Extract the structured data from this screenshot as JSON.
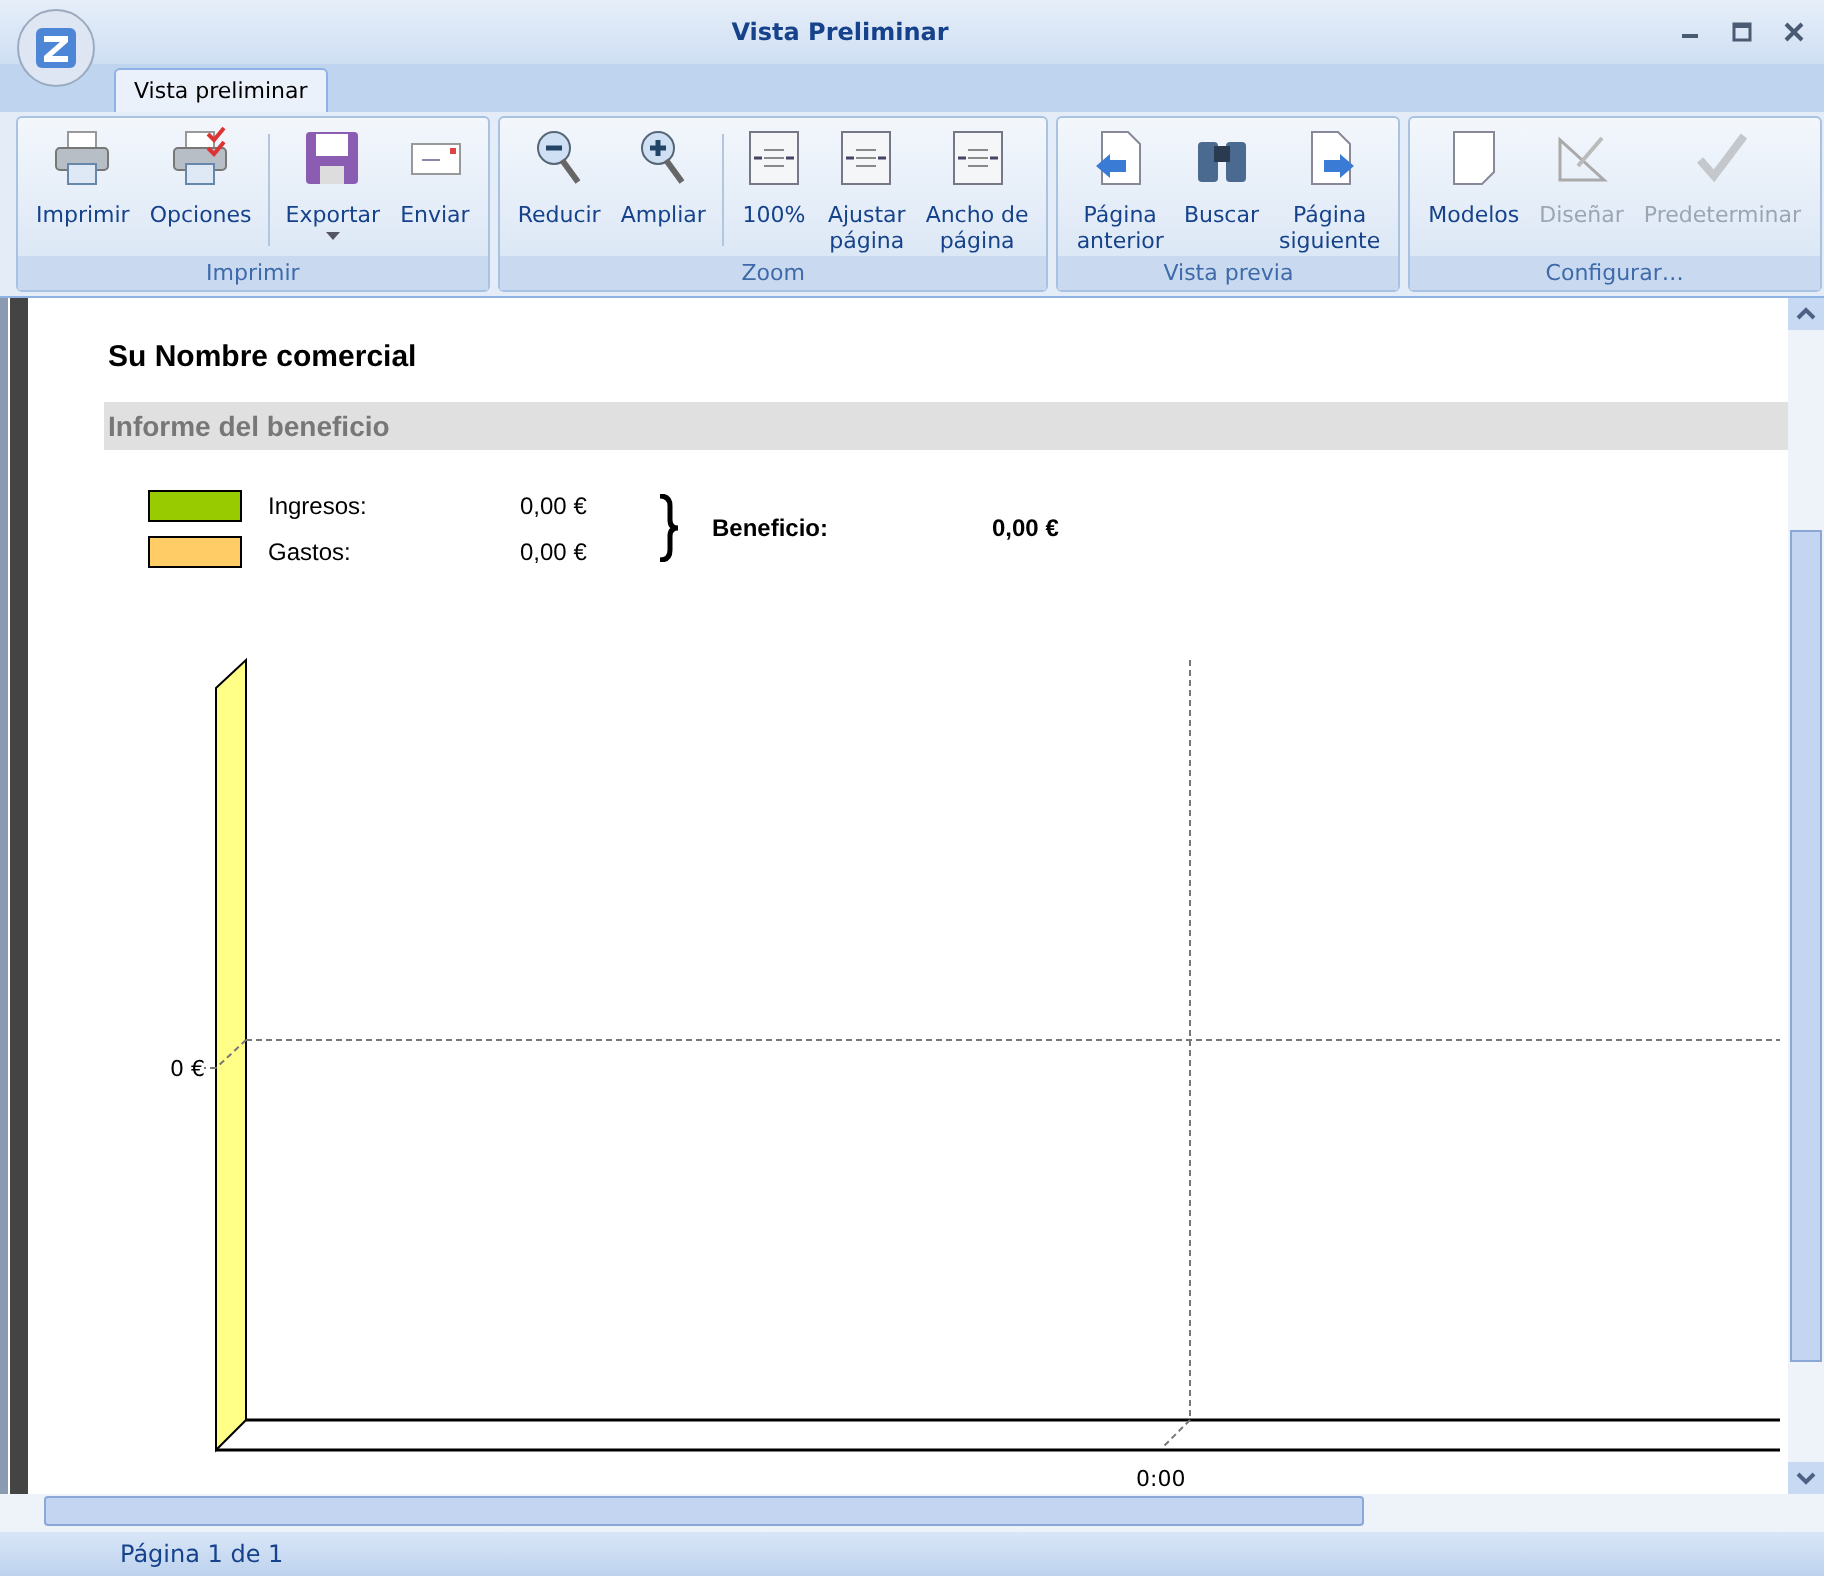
{
  "window": {
    "title": "Vista Preliminar"
  },
  "tabs": [
    {
      "label": "Vista preliminar",
      "selected": true
    }
  ],
  "ribbon": {
    "groups": [
      {
        "label": "Imprimir",
        "buttons": [
          {
            "label": "Imprimir",
            "disabled": false,
            "dropdown": false
          },
          {
            "label": "Opciones",
            "disabled": false,
            "dropdown": false
          },
          {
            "label": "Exportar",
            "disabled": false,
            "dropdown": true
          },
          {
            "label": "Enviar",
            "disabled": false,
            "dropdown": false
          }
        ]
      },
      {
        "label": "Zoom",
        "buttons": [
          {
            "label": "Reducir",
            "disabled": false,
            "dropdown": false
          },
          {
            "label": "Ampliar",
            "disabled": false,
            "dropdown": false
          },
          {
            "label": "100%",
            "disabled": false,
            "dropdown": false
          },
          {
            "label": "Ajustar\npágina",
            "disabled": false,
            "dropdown": false
          },
          {
            "label": "Ancho de\npágina",
            "disabled": false,
            "dropdown": false
          }
        ]
      },
      {
        "label": "Vista previa",
        "buttons": [
          {
            "label": "Página\nanterior",
            "disabled": false,
            "dropdown": false
          },
          {
            "label": "Buscar",
            "disabled": false,
            "dropdown": false
          },
          {
            "label": "Página\nsiguiente",
            "disabled": false,
            "dropdown": false
          }
        ]
      },
      {
        "label": "Configurar…",
        "buttons": [
          {
            "label": "Modelos",
            "disabled": false,
            "dropdown": false
          },
          {
            "label": "Diseñar",
            "disabled": true,
            "dropdown": false
          },
          {
            "label": "Predeterminar",
            "disabled": true,
            "dropdown": false
          }
        ]
      }
    ]
  },
  "report": {
    "company": "Su Nombre comercial",
    "section": "Informe del beneficio",
    "legend": [
      {
        "label": "Ingresos:",
        "value": "0,00 €",
        "color": "#99cc00"
      },
      {
        "label": "Gastos:",
        "value": "0,00 €",
        "color": "#ffcc66"
      }
    ],
    "result_label": "Beneficio:",
    "result_value": "0,00 €",
    "chart": {
      "y_tick": "0 €",
      "x_tick": "0:00"
    }
  },
  "status_bar": {
    "text": "Página 1 de 1"
  }
}
